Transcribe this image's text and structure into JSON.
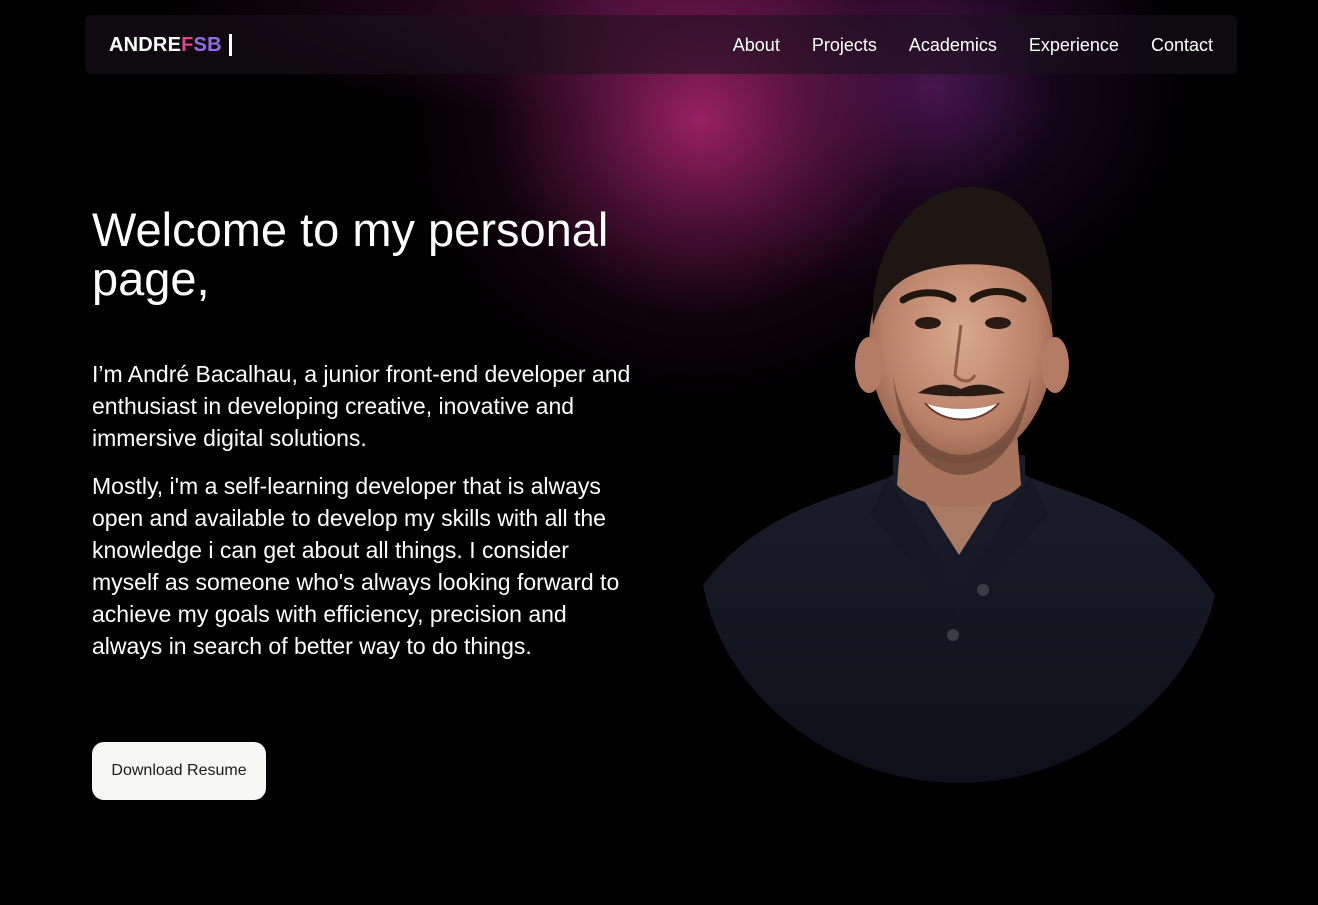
{
  "header": {
    "brand": {
      "part1": "ANDRE",
      "part2": "F",
      "part3": "SB"
    },
    "nav": {
      "about": "About",
      "projects": "Projects",
      "academics": "Academics",
      "experience": "Experience",
      "contact": "Contact"
    }
  },
  "hero": {
    "title": "Welcome to my personal page,",
    "intro": "I’m André Bacalhau, a junior front-end developer and enthusiast in developing creative, inovative and immersive digital solutions.",
    "intro2": "Mostly, i'm a self-learning developer that is always open and available to develop my skills with all the knowledge i can get about all things. I consider myself as someone who's always looking forward to achieve my goals with efficiency, precision and always in search of better way to do things.",
    "resume_button": "Download Resume"
  },
  "colors": {
    "background": "#000000",
    "glow_primary": "#a02269",
    "glow_secondary": "#5f1e6e",
    "brand_pink": "#e0458e",
    "brand_purple": "#8f6ee6",
    "button_bg": "#f7f7f5"
  },
  "icons": {
    "portrait": "profile-photo"
  }
}
